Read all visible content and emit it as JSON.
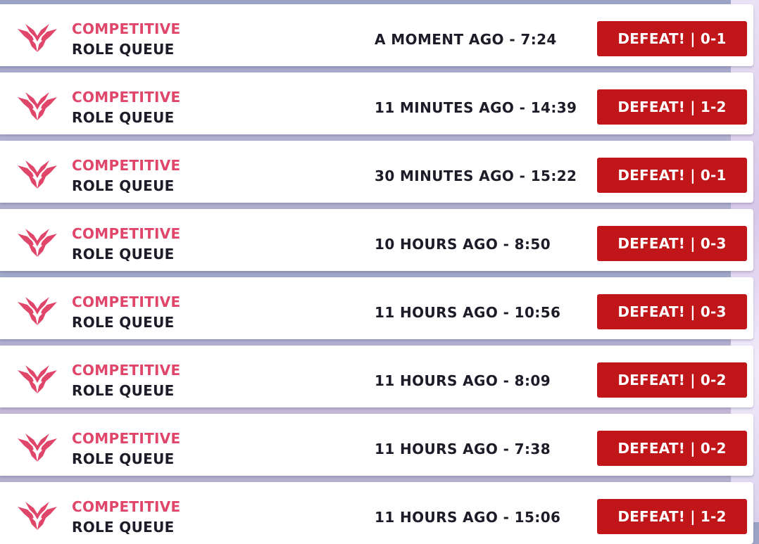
{
  "colors": {
    "mode_accent": "#e0466a",
    "defeat_red": "#c01519",
    "text_dark": "#1c1c28"
  },
  "icon_name": "competitive-wings-icon",
  "matches": [
    {
      "mode": "COMPETITIVE",
      "queue": "ROLE QUEUE",
      "time": "A MOMENT AGO - 7:24",
      "result": "DEFEAT! | 0-1"
    },
    {
      "mode": "COMPETITIVE",
      "queue": "ROLE QUEUE",
      "time": "11 MINUTES AGO - 14:39",
      "result": "DEFEAT! | 1-2"
    },
    {
      "mode": "COMPETITIVE",
      "queue": "ROLE QUEUE",
      "time": "30 MINUTES AGO - 15:22",
      "result": "DEFEAT! | 0-1"
    },
    {
      "mode": "COMPETITIVE",
      "queue": "ROLE QUEUE",
      "time": "10 HOURS AGO - 8:50",
      "result": "DEFEAT! | 0-3"
    },
    {
      "mode": "COMPETITIVE",
      "queue": "ROLE QUEUE",
      "time": "11 HOURS AGO - 10:56",
      "result": "DEFEAT! | 0-3"
    },
    {
      "mode": "COMPETITIVE",
      "queue": "ROLE QUEUE",
      "time": "11 HOURS AGO - 8:09",
      "result": "DEFEAT! | 0-2"
    },
    {
      "mode": "COMPETITIVE",
      "queue": "ROLE QUEUE",
      "time": "11 HOURS AGO - 7:38",
      "result": "DEFEAT! | 0-2"
    },
    {
      "mode": "COMPETITIVE",
      "queue": "ROLE QUEUE",
      "time": "11 HOURS AGO - 15:06",
      "result": "DEFEAT! | 1-2"
    }
  ]
}
